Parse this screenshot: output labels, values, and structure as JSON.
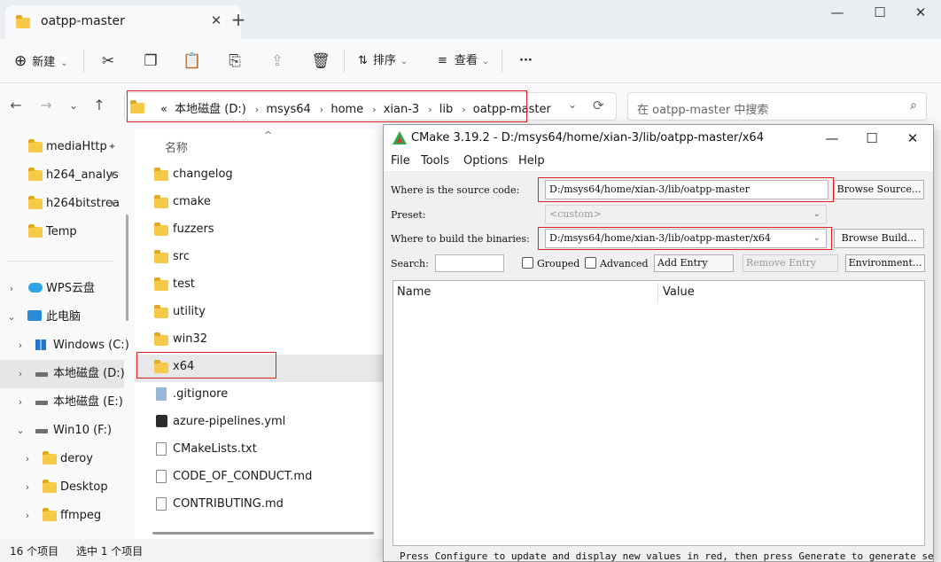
{
  "window": {
    "tab_title": "oatpp-master",
    "tab_close": "✕",
    "new_tab": "+",
    "min": "—",
    "max": "☐",
    "close": "✕"
  },
  "toolbar": {
    "new_label": "新建",
    "new_icon": "⊕",
    "sort_label": "排序",
    "view_label": "查看",
    "more": "···",
    "icons": [
      "cut-icon",
      "copy-icon",
      "paste-icon",
      "rename-icon",
      "share-icon",
      "delete-icon"
    ]
  },
  "address": {
    "prefix": "«",
    "crumbs": [
      "本地磁盘 (D:)",
      "msys64",
      "home",
      "xian-3",
      "lib",
      "oatpp-master"
    ],
    "separator": "›",
    "search_placeholder": "在 oatpp-master 中搜索"
  },
  "nav": {
    "back": "←",
    "forward": "→",
    "recent": "⌄",
    "up": "↑",
    "refresh": "⟳",
    "dropdown": "⌄"
  },
  "sidebar": {
    "quick": [
      {
        "label": "mediaHttp",
        "pinned": true
      },
      {
        "label": "h264_analys",
        "pinned": true
      },
      {
        "label": "h264bitstrea",
        "pinned": true
      },
      {
        "label": "Temp",
        "pinned": false
      }
    ],
    "tree": [
      {
        "label": "WPS云盘",
        "icon": "cloud-icon",
        "expander": "›"
      },
      {
        "label": "此电脑",
        "icon": "computer-icon",
        "expander": "⌄"
      },
      {
        "label": "Windows (C:)",
        "icon": "windows-drive-icon",
        "expander": "›"
      },
      {
        "label": "本地磁盘 (D:)",
        "icon": "drive-icon",
        "expander": "›"
      },
      {
        "label": "本地磁盘 (E:)",
        "icon": "drive-icon",
        "expander": "›"
      },
      {
        "label": "Win10 (F:)",
        "icon": "drive-icon",
        "expander": "⌄"
      },
      {
        "label": "deroy",
        "icon": "folder-icon",
        "expander": "›"
      },
      {
        "label": "Desktop",
        "icon": "folder-icon",
        "expander": "›"
      },
      {
        "label": "ffmpeg",
        "icon": "folder-icon",
        "expander": "›"
      }
    ],
    "pin_glyph": "📌"
  },
  "files": {
    "column_name": "名称",
    "sort_caret": "^",
    "items": [
      {
        "name": "changelog",
        "type": "folder"
      },
      {
        "name": "cmake",
        "type": "folder"
      },
      {
        "name": "fuzzers",
        "type": "folder"
      },
      {
        "name": "src",
        "type": "folder"
      },
      {
        "name": "test",
        "type": "folder"
      },
      {
        "name": "utility",
        "type": "folder"
      },
      {
        "name": "win32",
        "type": "folder"
      },
      {
        "name": "x64",
        "type": "folder",
        "selected": true
      },
      {
        "name": ".gitignore",
        "type": "git"
      },
      {
        "name": "azure-pipelines.yml",
        "type": "yml"
      },
      {
        "name": "CMakeLists.txt",
        "type": "text"
      },
      {
        "name": "CODE_OF_CONDUCT.md",
        "type": "md"
      },
      {
        "name": "CONTRIBUTING.md",
        "type": "md"
      }
    ]
  },
  "status": {
    "count": "16 个项目",
    "selected": "选中 1 个项目"
  },
  "cmake": {
    "title": "CMake 3.19.2 - D:/msys64/home/xian-3/lib/oatpp-master/x64",
    "menus": [
      "File",
      "Tools",
      "Options",
      "Help"
    ],
    "source_label": "Where is the source code:",
    "source_value": "D:/msys64/home/xian-3/lib/oatpp-master",
    "browse_source": "Browse Source...",
    "preset_label": "Preset:",
    "preset_value": "<custom>",
    "build_label": "Where to build the binaries:",
    "build_value": "D:/msys64/home/xian-3/lib/oatpp-master/x64",
    "browse_build": "Browse Build...",
    "search_label": "Search:",
    "search_value": "",
    "grouped": "Grouped",
    "advanced": "Advanced",
    "add_entry": "Add Entry",
    "remove_entry": "Remove Entry",
    "environment": "Environment...",
    "col_name": "Name",
    "col_value": "Value",
    "hint": "Press Configure to update and display new values in red, then press Generate to generate selected"
  },
  "colors": {
    "highlight": "#e02020",
    "folder": "#f7c948"
  }
}
